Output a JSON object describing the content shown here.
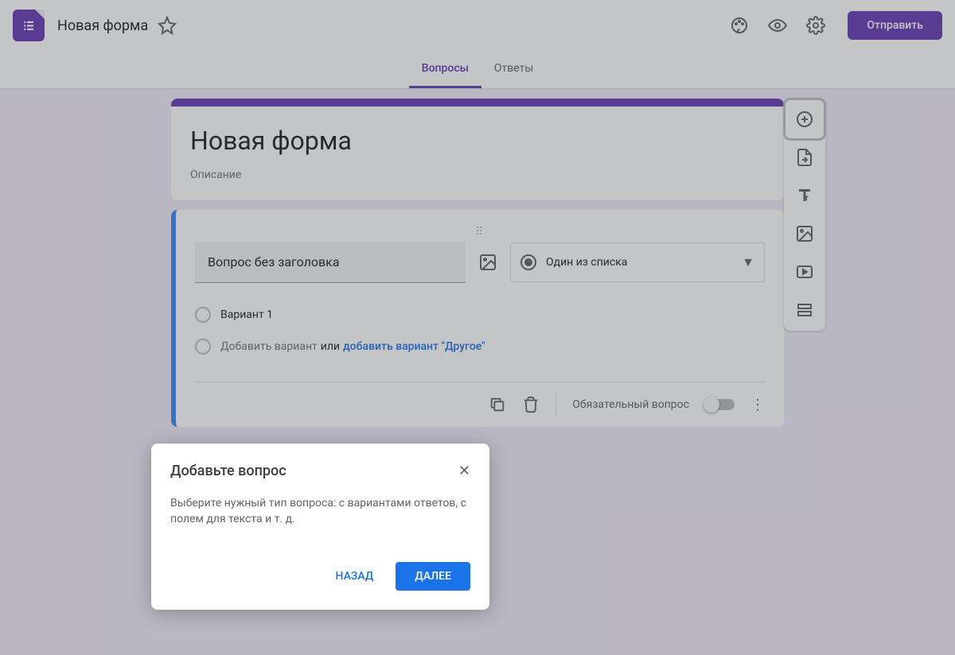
{
  "header": {
    "form_name": "Новая форма",
    "send_label": "Отправить"
  },
  "tabs": {
    "questions": "Вопросы",
    "responses": "Ответы"
  },
  "title_card": {
    "title": "Новая форма",
    "description": "Описание"
  },
  "question": {
    "title": "Вопрос без заголовка",
    "type_label": "Один из списка",
    "option1": "Вариант 1",
    "add_option": "Добавить вариант",
    "or": "или",
    "add_other": "добавить вариант \"Другое\"",
    "required_label": "Обязательный вопрос"
  },
  "popover": {
    "title": "Добавьте вопрос",
    "body": "Выберите нужный тип вопроса: с вариантами ответов, с полем для текста и т. д.",
    "back": "НАЗАД",
    "next": "ДАЛЕЕ"
  }
}
